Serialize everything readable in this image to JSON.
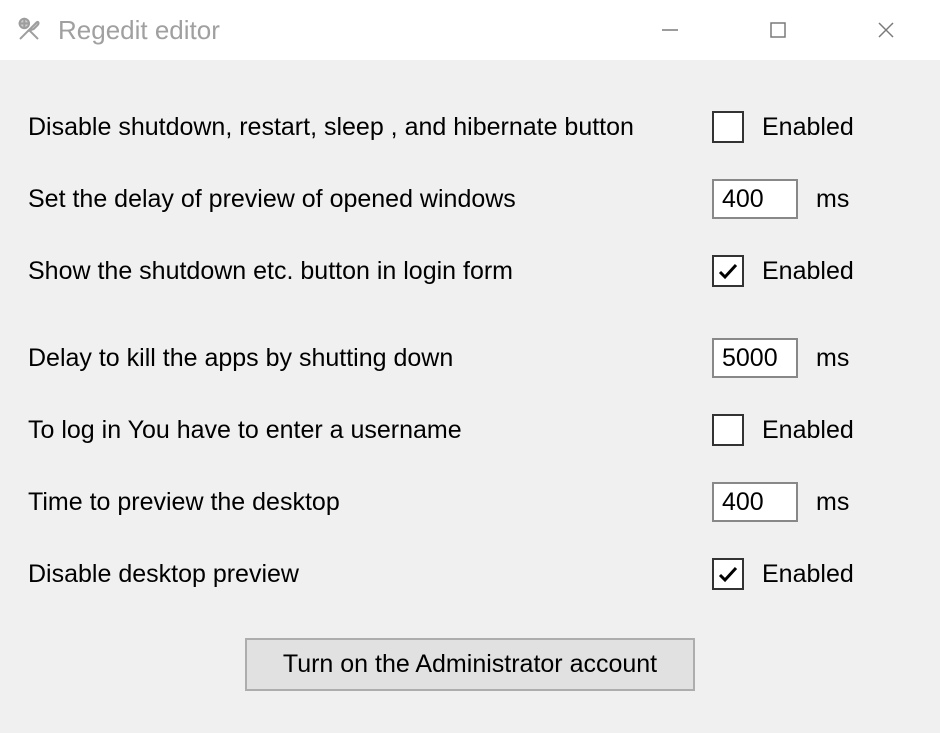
{
  "window": {
    "title": "Regedit editor"
  },
  "rows": [
    {
      "label": "Disable shutdown, restart, sleep , and hibernate button",
      "type": "checkbox",
      "checked": false,
      "suffix": "Enabled"
    },
    {
      "label": "Set the delay of preview of opened windows",
      "type": "number",
      "value": "400",
      "suffix": "ms"
    },
    {
      "label": "Show the shutdown etc. button in login form",
      "type": "checkbox",
      "checked": true,
      "suffix": "Enabled"
    },
    {
      "label": "Delay to kill the apps by shutting down",
      "type": "number",
      "value": "5000",
      "suffix": "ms",
      "gap": true
    },
    {
      "label": "To log in You have to enter a username",
      "type": "checkbox",
      "checked": false,
      "suffix": "Enabled"
    },
    {
      "label": "Time to preview the desktop",
      "type": "number",
      "value": "400",
      "suffix": "ms"
    },
    {
      "label": "Disable desktop preview",
      "type": "checkbox",
      "checked": true,
      "suffix": "Enabled"
    }
  ],
  "button": {
    "admin_label": "Turn on the Administrator account"
  }
}
